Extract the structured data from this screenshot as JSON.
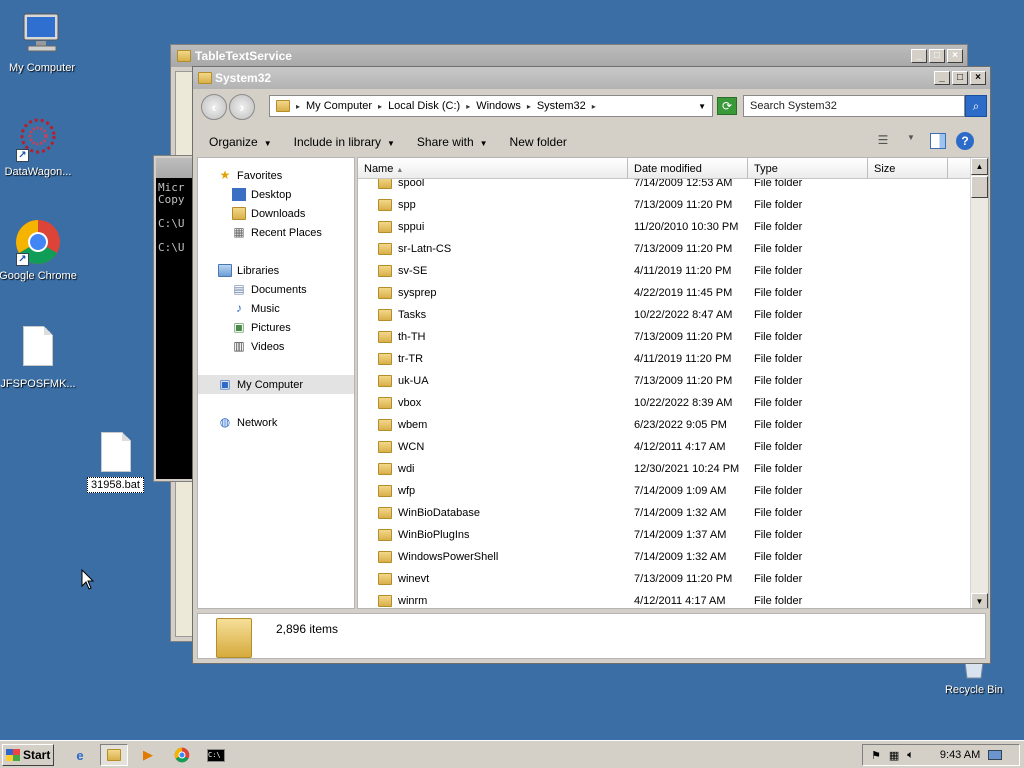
{
  "desktop": {
    "icons": [
      {
        "label": "My Computer",
        "icon": "computer-icon"
      },
      {
        "label": "DataWagon...",
        "icon": "datawagon-icon"
      },
      {
        "label": "Google Chrome",
        "icon": "chrome-icon"
      },
      {
        "label": "JFSPOSFMK...",
        "icon": "file-icon"
      },
      {
        "label": "Recycle Bin",
        "icon": "recycle-bin-icon"
      }
    ],
    "bat_file": "31958.bat"
  },
  "bg_window": {
    "title": "TableTextService"
  },
  "cmd_window": {
    "lines": [
      "Micr",
      "Copy",
      "",
      "C:\\U",
      "",
      "C:\\U"
    ]
  },
  "explorer": {
    "title": "System32",
    "breadcrumb": [
      "My Computer",
      "Local Disk (C:)",
      "Windows",
      "System32"
    ],
    "search_placeholder": "Search System32",
    "toolbar": {
      "organize": "Organize",
      "include": "Include in library",
      "share": "Share with",
      "new_folder": "New folder"
    },
    "nav": {
      "favorites": "Favorites",
      "desktop": "Desktop",
      "downloads": "Downloads",
      "recent": "Recent Places",
      "libraries": "Libraries",
      "documents": "Documents",
      "music": "Music",
      "pictures": "Pictures",
      "videos": "Videos",
      "my_computer": "My Computer",
      "network": "Network"
    },
    "columns": {
      "name": "Name",
      "date": "Date modified",
      "type": "Type",
      "size": "Size"
    },
    "rows": [
      {
        "name": "spool",
        "date": "7/14/2009 12:53 AM",
        "type": "File folder"
      },
      {
        "name": "spp",
        "date": "7/13/2009 11:20 PM",
        "type": "File folder"
      },
      {
        "name": "sppui",
        "date": "11/20/2010 10:30 PM",
        "type": "File folder"
      },
      {
        "name": "sr-Latn-CS",
        "date": "7/13/2009 11:20 PM",
        "type": "File folder"
      },
      {
        "name": "sv-SE",
        "date": "4/11/2019 11:20 PM",
        "type": "File folder"
      },
      {
        "name": "sysprep",
        "date": "4/22/2019 11:45 PM",
        "type": "File folder"
      },
      {
        "name": "Tasks",
        "date": "10/22/2022 8:47 AM",
        "type": "File folder"
      },
      {
        "name": "th-TH",
        "date": "7/13/2009 11:20 PM",
        "type": "File folder"
      },
      {
        "name": "tr-TR",
        "date": "4/11/2019 11:20 PM",
        "type": "File folder"
      },
      {
        "name": "uk-UA",
        "date": "7/13/2009 11:20 PM",
        "type": "File folder"
      },
      {
        "name": "vbox",
        "date": "10/22/2022 8:39 AM",
        "type": "File folder"
      },
      {
        "name": "wbem",
        "date": "6/23/2022 9:05 PM",
        "type": "File folder"
      },
      {
        "name": "WCN",
        "date": "4/12/2011 4:17 AM",
        "type": "File folder"
      },
      {
        "name": "wdi",
        "date": "12/30/2021 10:24 PM",
        "type": "File folder"
      },
      {
        "name": "wfp",
        "date": "7/14/2009 1:09 AM",
        "type": "File folder"
      },
      {
        "name": "WinBioDatabase",
        "date": "7/14/2009 1:32 AM",
        "type": "File folder"
      },
      {
        "name": "WinBioPlugIns",
        "date": "7/14/2009 1:37 AM",
        "type": "File folder"
      },
      {
        "name": "WindowsPowerShell",
        "date": "7/14/2009 1:32 AM",
        "type": "File folder"
      },
      {
        "name": "winevt",
        "date": "7/13/2009 11:20 PM",
        "type": "File folder"
      },
      {
        "name": "winrm",
        "date": "4/12/2011 4:17 AM",
        "type": "File folder"
      }
    ],
    "item_count": "2,896 items"
  },
  "taskbar": {
    "start": "Start",
    "clock": "9:43 AM"
  },
  "colors": {
    "desktop": "#3a6ea5",
    "accent": "#2d6bc9"
  }
}
